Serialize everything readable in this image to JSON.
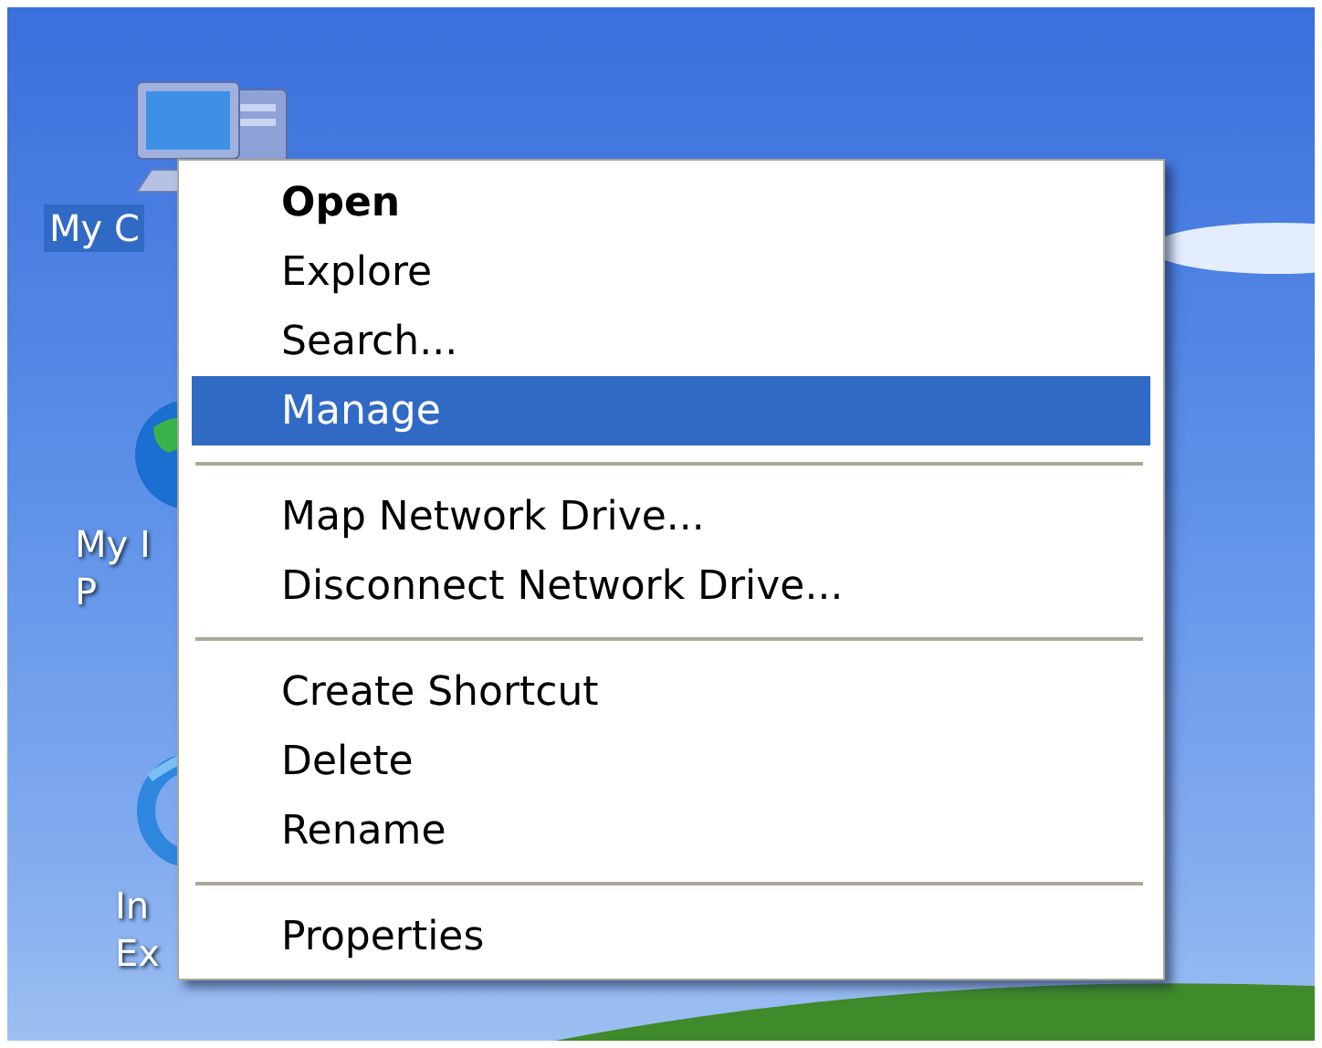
{
  "desktop_icons": [
    {
      "kind": "computer",
      "label": [
        "My C"
      ],
      "selected": true
    },
    {
      "kind": "globe",
      "label": [
        "My I",
        "P"
      ],
      "selected": false
    },
    {
      "kind": "browser",
      "label": [
        "In",
        "Ex"
      ],
      "selected": false
    }
  ],
  "context_menu": {
    "items": [
      {
        "kind": "default",
        "label": "Open",
        "selected": false
      },
      {
        "kind": "item",
        "label": "Explore",
        "selected": false
      },
      {
        "kind": "item",
        "label": "Search...",
        "selected": false
      },
      {
        "kind": "item",
        "label": "Manage",
        "selected": true
      },
      {
        "kind": "separator"
      },
      {
        "kind": "item",
        "label": "Map Network Drive...",
        "selected": false
      },
      {
        "kind": "item",
        "label": "Disconnect Network Drive...",
        "selected": false
      },
      {
        "kind": "separator"
      },
      {
        "kind": "item",
        "label": "Create Shortcut",
        "selected": false
      },
      {
        "kind": "item",
        "label": "Delete",
        "selected": false
      },
      {
        "kind": "item",
        "label": "Rename",
        "selected": false
      },
      {
        "kind": "separator"
      },
      {
        "kind": "item",
        "label": "Properties",
        "selected": false
      }
    ]
  }
}
